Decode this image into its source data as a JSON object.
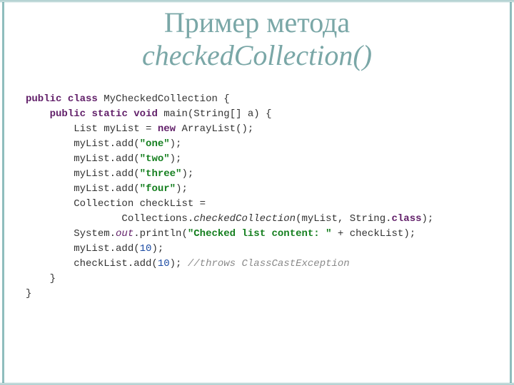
{
  "title": {
    "line1": "Пример метода",
    "line2": "checkedCollection()"
  },
  "kw": {
    "public": "public",
    "class": "class",
    "static": "static",
    "void": "void",
    "new": "new",
    "classkw": "class"
  },
  "code": {
    "class_name": "MyCheckedCollection",
    "main_sig": "main(String[] a) {",
    "list_decl_a": "List myList = ",
    "list_decl_b": " ArrayList();",
    "add1": "myList.add(",
    "add2": "myList.add(",
    "add3": "myList.add(",
    "add4": "myList.add(",
    "s_one": "\"one\"",
    "s_two": "\"two\"",
    "s_three": "\"three\"",
    "s_four": "\"four\"",
    "close": ");",
    "coll_decl": "Collection checkList =",
    "coll_call_a": "Collections.",
    "coll_method": "checkedCollection",
    "coll_call_b": "(myList, String.",
    "coll_call_c": ");",
    "out_a": "System.",
    "out_field": "out",
    "out_b": ".println(",
    "out_str": "\"Checked list content: \"",
    "out_c": " + checkList);",
    "addnum1_a": "myList.add(",
    "num10a": "10",
    "addnum1_b": ");",
    "addnum2_a": "checkList.add(",
    "num10b": "10",
    "addnum2_b": "); ",
    "comment": "//throws ClassCastException",
    "brace_close": "}"
  }
}
